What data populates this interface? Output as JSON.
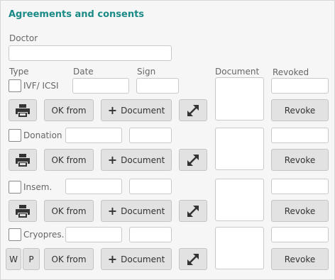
{
  "title": "Agreements and consents",
  "doctor": {
    "label": "Doctor",
    "value": ""
  },
  "columns": {
    "type": "Type",
    "date": "Date",
    "sign": "Sign",
    "document": "Document",
    "revoked": "Revoked"
  },
  "rows": [
    {
      "type": "IVF/ ICSI",
      "checked": false
    },
    {
      "type": "Donation",
      "checked": false
    },
    {
      "type": "Insem.",
      "checked": false
    },
    {
      "type": "Cryopres.",
      "checked": false
    }
  ],
  "buttons": {
    "ok_from": "OK from",
    "document": "Document",
    "revoke": "Revoke",
    "w": "W",
    "p": "P"
  },
  "icons": {
    "print": "printer-icon",
    "expand": "expand-arrows-icon",
    "plus": "plus-icon"
  }
}
